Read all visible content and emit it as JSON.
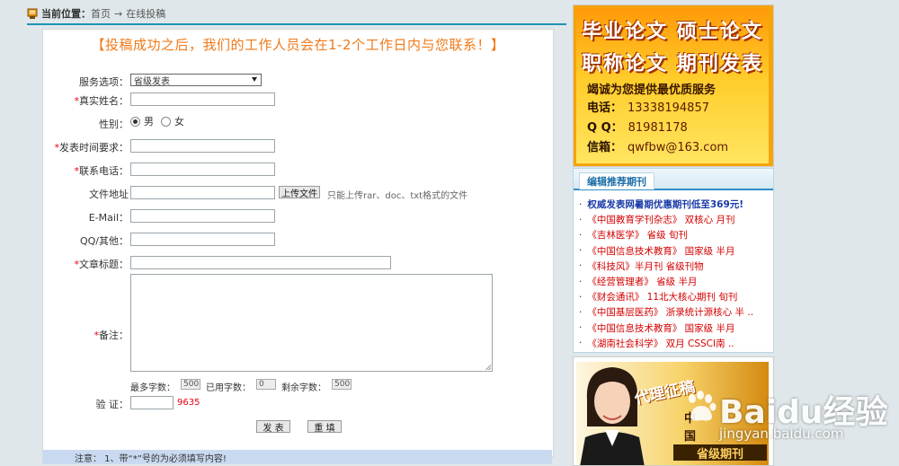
{
  "breadcrumb": {
    "label": "当前位置：",
    "home": "首页",
    "separator": "→",
    "current": "在线投稿"
  },
  "form": {
    "notice": "【投稿成功之后，我们的工作人员会在1-2个工作日内与您联系！】",
    "required_mark": "*",
    "service_label": "服务选项：",
    "service_value": "省级发表",
    "name_label": "真实姓名：",
    "gender_label": "性别：",
    "gender_male": "男",
    "gender_female": "女",
    "gender_selected": "男",
    "time_label": "发表时间要求：",
    "phone_label": "联系电话：",
    "file_label": "文件地址",
    "upload_button": "上传文件",
    "upload_hint": "只能上传rar、doc、txt格式的文件",
    "email_label": "E-Mail：",
    "qq_label": "QQ/其他：",
    "title_label": "文章标题：",
    "remark_label": "备注：",
    "max_chars_label": "最多字数：",
    "max_chars_value": "500",
    "used_chars_label": "已用字数：",
    "used_chars_value": "0",
    "remaining_chars_label": "剩余字数：",
    "remaining_chars_value": "500",
    "captcha_label": "验  证：",
    "captcha_code": "9635",
    "submit_button": "发 表",
    "reset_button": "重 填",
    "footer_note": "注意：   1、带“*”号的为必须填写内容!"
  },
  "ad_top": {
    "line1": "毕业论文 硕士论文",
    "line2": "职称论文 期刊发表",
    "slogan": "竭诚为您提供最优质服务",
    "phone_label": "电话：",
    "phone": "13338194857",
    "qq_label": "Q Q：",
    "qq": "81981178",
    "email_label": "信箱：",
    "email": "qwfbw@163.com"
  },
  "journals": {
    "tab": "编辑推荐期刊",
    "items": [
      "权威发表网暑期优惠期刊低至369元!",
      "《中国教育学刊杂志》 双核心 月刊",
      "《吉林医学》 省级 旬刊",
      "《中国信息技术教育》 国家级 半月",
      "《科技风》半月刊 省级刊物",
      "《经营管理者》 省级 半月",
      "《财会通讯》 11北大核心期刊 旬刊",
      "《中国基层医药》 浙录统计源核心 半 ..",
      "《中国信息技术教育》 国家级 半月",
      "《湖南社会科学》 双月 CSSCI南 .."
    ]
  },
  "ad_bottom": {
    "tag": "代理征稿",
    "text1": "中",
    "text2": "国",
    "banner": "省级期刊"
  },
  "watermark": {
    "text": "Baidu经验",
    "url": "jingyan.baidu.com"
  },
  "colors": {
    "accent": "#1e93b4",
    "notice": "#f07a1a",
    "required": "#e60012",
    "journal_red": "#d40000",
    "journal_blue": "#1a3aa8"
  }
}
